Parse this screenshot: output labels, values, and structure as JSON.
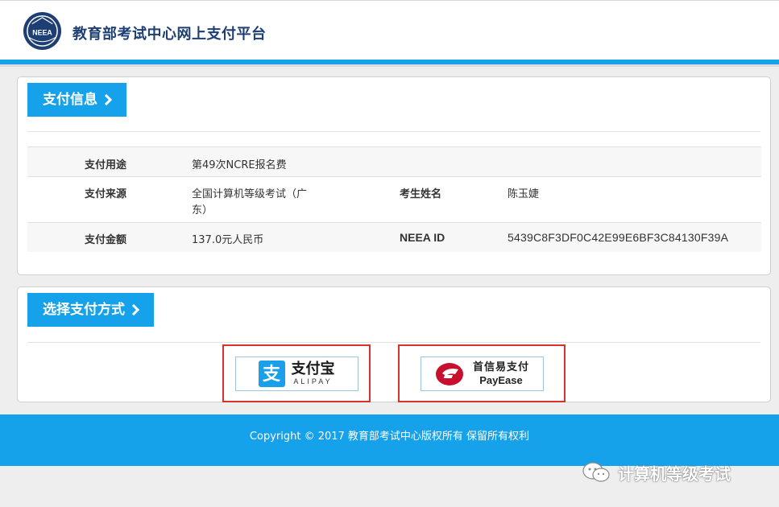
{
  "header": {
    "logo_text": "NEEA",
    "site_title": "教育部考试中心网上支付平台"
  },
  "payment_info": {
    "heading": "支付信息",
    "rows": [
      {
        "label": "支付用途",
        "value": "第49次NCRE报名费"
      },
      {
        "label": "支付来源",
        "value_line1": "全国计算机等级考试（广",
        "value_line2": "东）",
        "label2": "考生姓名",
        "value2": "陈玉婕"
      },
      {
        "label": "支付金额",
        "value": "137.0元人民币",
        "label2": "NEEA ID",
        "value2": "5439C8F3DF0C42E99E6BF3C84130F39A"
      }
    ]
  },
  "payment_method": {
    "heading": "选择支付方式",
    "options": [
      {
        "name_cn": "支付宝",
        "name_en": "ALIPAY",
        "icon": "alipay-icon"
      },
      {
        "name_cn": "首信易支付",
        "name_en": "PayEase",
        "icon": "payease-icon"
      }
    ]
  },
  "footer": {
    "copyright": "Copyright © 2017 教育部考试中心版权所有 保留所有权利"
  },
  "watermark": {
    "text": "计算机等级考试",
    "icon": "wechat-icon"
  },
  "colors": {
    "accent": "#16a2ea",
    "title": "#1d3f73",
    "highlight_border": "#d9322b",
    "page_bg": "#eeeeee"
  }
}
